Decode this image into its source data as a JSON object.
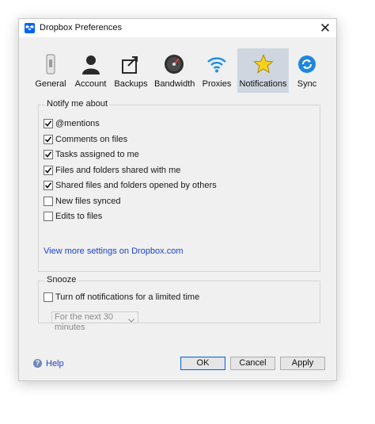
{
  "window": {
    "title": "Dropbox Preferences",
    "close_glyph": "✕"
  },
  "tabs": [
    {
      "label": "General",
      "icon": "switch-icon",
      "selected": false
    },
    {
      "label": "Account",
      "icon": "person-icon",
      "selected": false
    },
    {
      "label": "Backups",
      "icon": "backup-icon",
      "selected": false
    },
    {
      "label": "Bandwidth",
      "icon": "gauge-icon",
      "selected": false
    },
    {
      "label": "Proxies",
      "icon": "wifi-icon",
      "selected": false
    },
    {
      "label": "Notifications",
      "icon": "star-icon",
      "selected": true
    },
    {
      "label": "Sync",
      "icon": "sync-icon",
      "selected": false
    }
  ],
  "notify": {
    "title": "Notify me about",
    "options": [
      {
        "label": "@mentions",
        "checked": true
      },
      {
        "label": "Comments on files",
        "checked": true
      },
      {
        "label": "Tasks assigned to me",
        "checked": true
      },
      {
        "label": "Files and folders shared with me",
        "checked": true
      },
      {
        "label": "Shared files and folders opened by others",
        "checked": true
      },
      {
        "label": "New files synced",
        "checked": false
      },
      {
        "label": "Edits to files",
        "checked": false
      }
    ],
    "more_link": "View more settings on Dropbox.com"
  },
  "snooze": {
    "title": "Snooze",
    "option": {
      "label": "Turn off notifications for a limited time",
      "checked": false
    },
    "duration_value": "For the next 30 minutes"
  },
  "footer": {
    "help_label": "Help",
    "ok_label": "OK",
    "cancel_label": "Cancel",
    "apply_label": "Apply"
  },
  "colors": {
    "accent": "#0061fe",
    "selected_tab": "#cfd6df",
    "link": "#1a44c8"
  }
}
